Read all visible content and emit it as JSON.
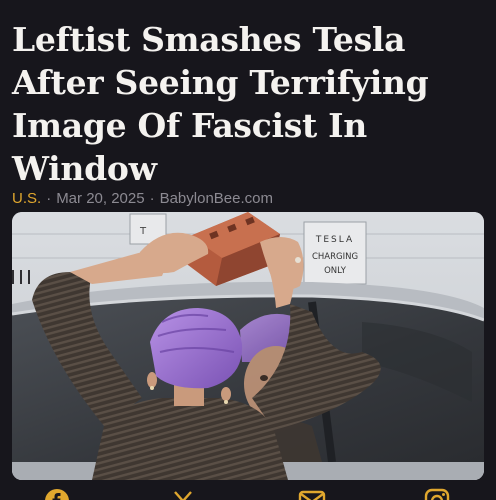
{
  "article": {
    "headline": "Leftist Smashes Tesla After Seeing Terrifying Image Of Fascist In Window",
    "category": "U.S.",
    "date": "Mar 20, 2025",
    "source": "BabylonBee.com",
    "separator": "·"
  },
  "image": {
    "sign_brand": "TESLA",
    "sign_line1": "CHARGING",
    "sign_line2": "ONLY",
    "sign_partial": "T"
  },
  "share": {
    "icons": [
      "facebook-icon",
      "x-icon",
      "email-icon",
      "instagram-icon"
    ]
  },
  "colors": {
    "background": "#17161c",
    "headline": "#f4f2ef",
    "category": "#e0a72e",
    "meta": "#8c8a92",
    "hair": "#9a6fd0",
    "brick": "#b45b3e"
  }
}
